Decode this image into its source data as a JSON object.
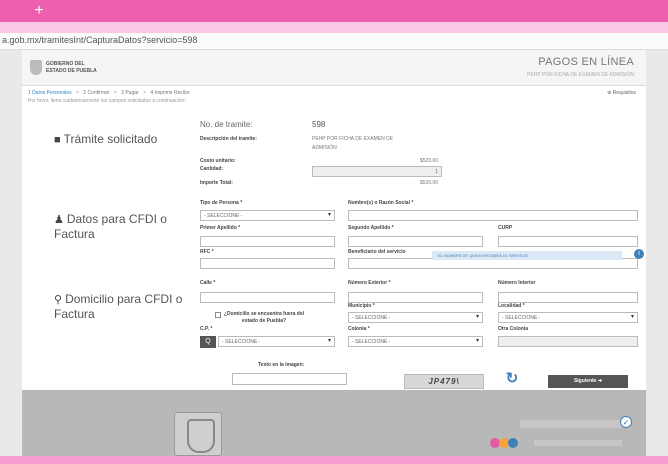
{
  "browser": {
    "new_tab_label": "+",
    "url": "a.gob.mx/tramitesInt/CapturaDatos?servicio=598"
  },
  "header": {
    "logo_line1": "GOBIERNO DEL",
    "logo_line2": "ESTADO DE PUEBLA",
    "title": "PAGOS EN LÍNEA",
    "subtitle": "PEHP POR FICHA DE EXAMEN DE ADMISIÓN"
  },
  "steps": {
    "step1": "1 Datos Personales",
    "step2": "2 Confirmar",
    "step3": "3 Pagar",
    "step4": "4 Imprimir Recibo",
    "separator": ">",
    "requirements": "⊕ Requisitos",
    "intro": "Por favor, llena cuidadosamente los campos solicitados a continuación:"
  },
  "tramite": {
    "section_title": "Trámite solicitado",
    "icon": "document-icon",
    "no_label": "No. de tramite:",
    "no_value": "598",
    "desc_label": "Descripción del tramite:",
    "desc_value_line1": "PEHP POR FICHA DE EXAMEN DE",
    "desc_value_line2": "ADMISIÓN",
    "costo_label": "Costo unitario:",
    "costo_value": "$520.00",
    "cantidad_label": "Cantidad:",
    "cantidad_value": "1",
    "importe_label": "Importe Total:",
    "importe_value": "$520.00"
  },
  "cfdi": {
    "section_title_line1": "Datos para CFDI o",
    "section_title_line2": "Factura",
    "icon": "user-icon",
    "tipo_label": "Tipo de Persona *",
    "tipo_value": "- SELECCIONE -",
    "nombre_label": "Nombre(s) o Razón Social *",
    "primer_label": "Primer Apellido *",
    "segundo_label": "Segundo Apellido *",
    "curp_label": "CURP",
    "rfc_label": "RFC *",
    "beneficiario_label": "Beneficiario del servicio",
    "notice": "EL NOMBRE DE QUIEN RECIBIRÁ EL SERVICIO",
    "info_glyph": "i"
  },
  "domicilio": {
    "section_title_line1": "Domicilio para CFDI o",
    "section_title_line2": "Factura",
    "icon": "map-marker-icon",
    "calle_label": "Calle *",
    "ext_label": "Número Exterior *",
    "int_label": "Número Interior",
    "fuera_label_line1": "¿Domicilio se encuentra fuera del",
    "fuera_label_line2": "estado de Puebla?",
    "municipio_label": "Municipio *",
    "municipio_value": "- SELECCIONE -",
    "localidad_label": "Localidad *",
    "localidad_value": "- SELECCIONE -",
    "cp_label": "C.P. *",
    "cp_value": "- SELECCIONE -",
    "colonia_label": "Colonia *",
    "colonia_value": "- SELECCIONE -",
    "otra_label": "Otra Colonia",
    "search_glyph": "Q"
  },
  "captcha": {
    "label": "Texto en la imagen:",
    "image_text": "JP479\\",
    "refresh_glyph": "↻",
    "next_label": "Siguiente ➔"
  },
  "footer": {
    "check_glyph": "✓",
    "dot_colors": [
      "#e35aa5",
      "#f5a33b",
      "#3f80b8"
    ]
  }
}
